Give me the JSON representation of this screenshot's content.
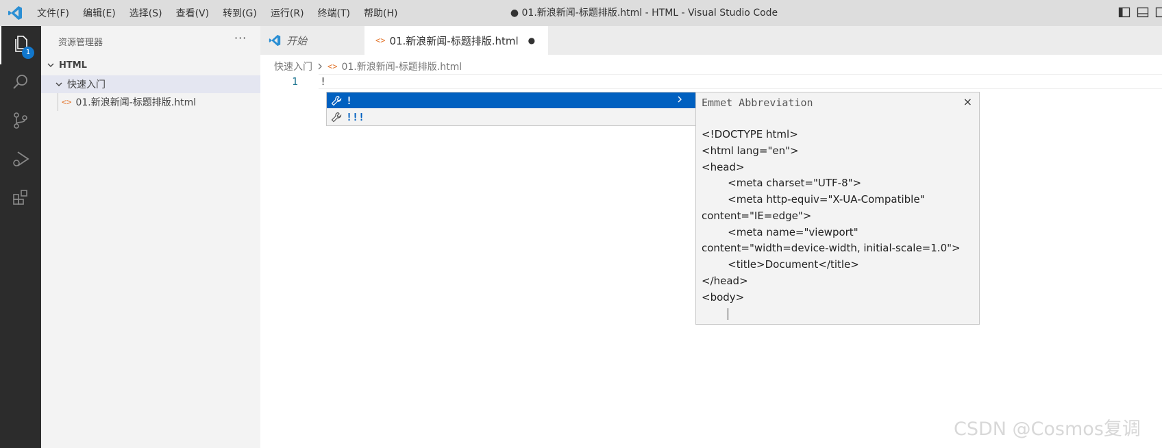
{
  "titlebar": {
    "menu": [
      "文件(F)",
      "编辑(E)",
      "选择(S)",
      "查看(V)",
      "转到(G)",
      "运行(R)",
      "终端(T)",
      "帮助(H)"
    ],
    "window_title": "● 01.新浪新闻-标题排版.html - HTML - Visual Studio Code"
  },
  "activitybar": {
    "explorer_badge": "1"
  },
  "sidebar": {
    "title": "资源管理器",
    "more": "···",
    "root": "HTML",
    "folder": "快速入门",
    "file": "01.新浪新闻-标题排版.html"
  },
  "tabs": [
    {
      "label": "开始"
    },
    {
      "label": "01.新浪新闻-标题排版.html",
      "dirty": "●"
    }
  ],
  "breadcrumb": {
    "folder": "快速入门",
    "file": "01.新浪新闻-标题排版.html"
  },
  "editor": {
    "line_number": "1",
    "line_text": "!"
  },
  "suggest": {
    "items": [
      {
        "label": "!"
      },
      {
        "label": "!!!"
      }
    ]
  },
  "details": {
    "header": "Emmet Abbreviation",
    "close": "×",
    "lines": [
      "<!DOCTYPE html>",
      "<html lang=\"en\">",
      "<head>",
      "        <meta charset=\"UTF-8\">",
      "        <meta http-equiv=\"X-UA-Compatible\"",
      "content=\"IE=edge\">",
      "        <meta name=\"viewport\"",
      "content=\"width=device-width, initial-scale=1.0\">",
      "        <title>Document</title>",
      "</head>",
      "<body>"
    ]
  },
  "watermark": "CSDN @Cosmos复调",
  "colors": {
    "accent": "#0060c0",
    "activitybar": "#2c2c2c",
    "badge": "#1177cc"
  }
}
